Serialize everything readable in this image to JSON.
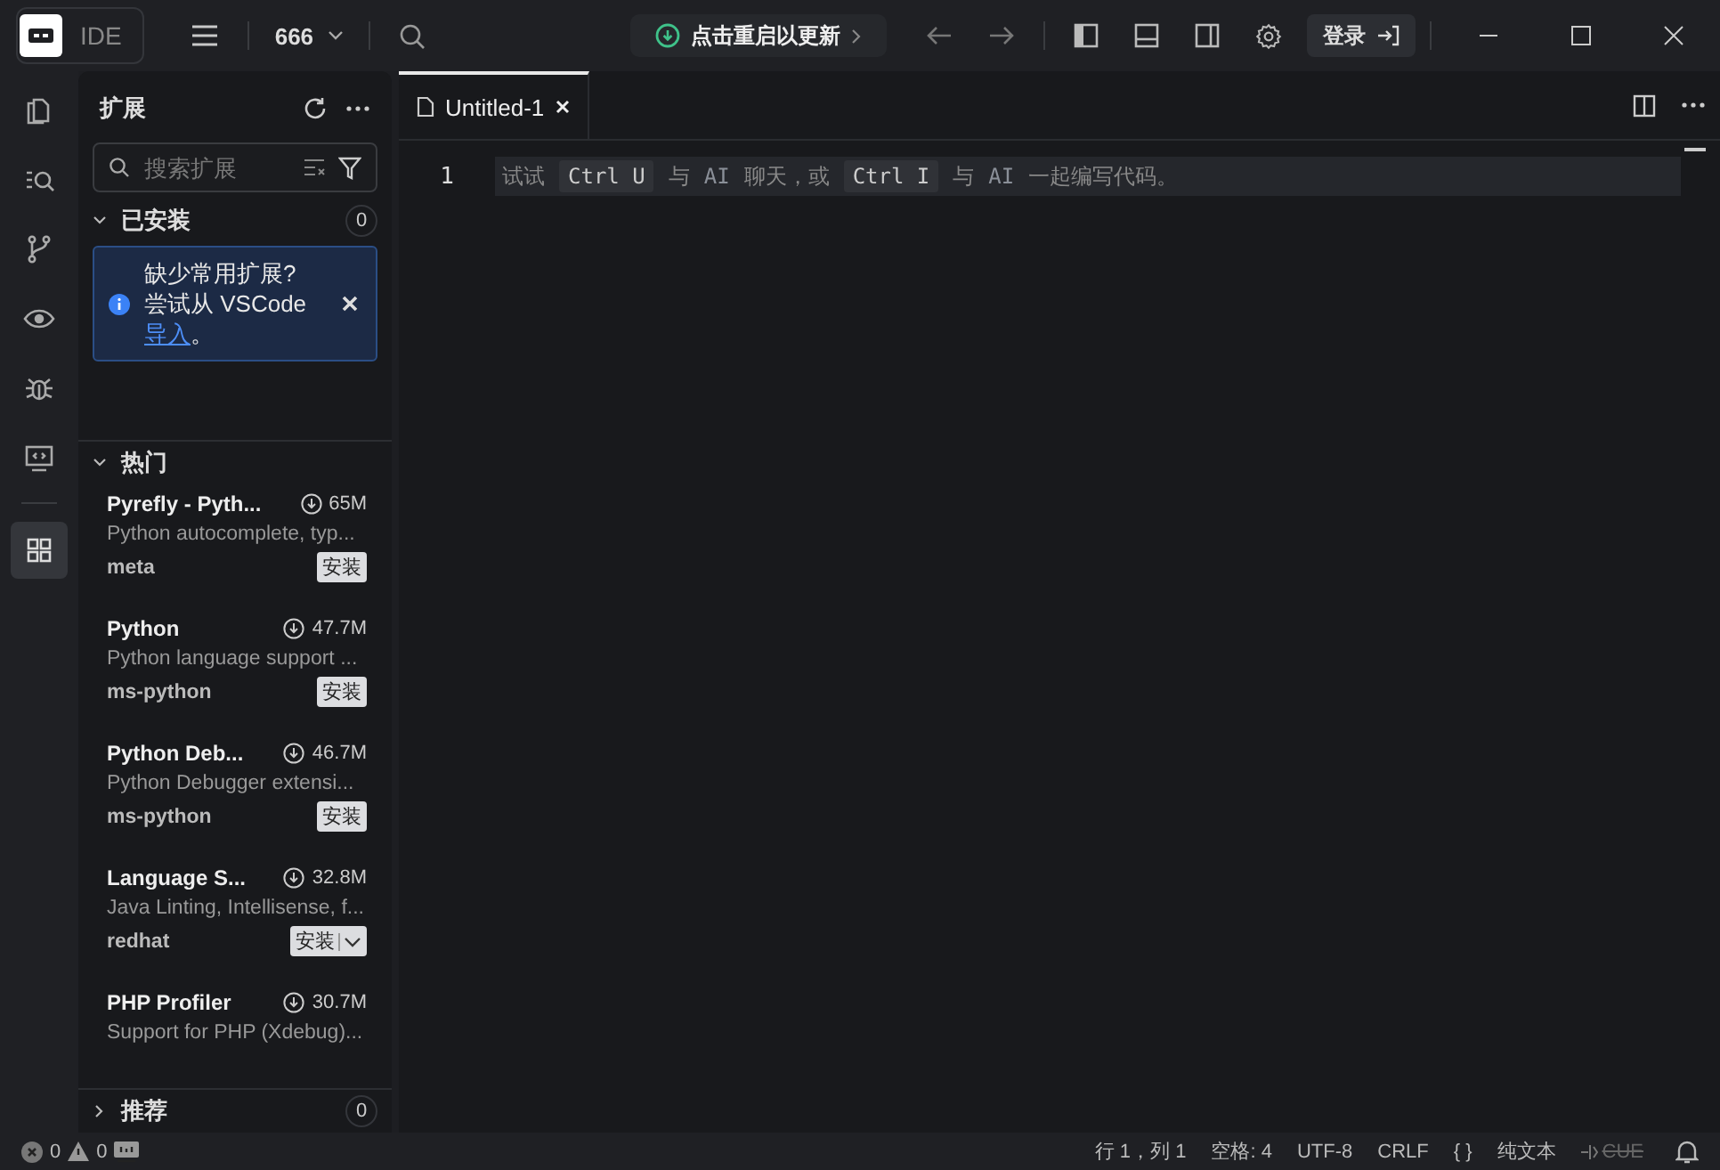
{
  "titlebar": {
    "app_label": "IDE",
    "project": "666",
    "update_button": "点击重启以更新",
    "login_button": "登录"
  },
  "activity_bar": [
    {
      "kind": "files",
      "selected": false
    },
    {
      "kind": "search",
      "selected": false
    },
    {
      "kind": "branch",
      "selected": false
    },
    {
      "kind": "eye",
      "selected": false
    },
    {
      "kind": "bug",
      "selected": false
    },
    {
      "kind": "monitor",
      "selected": false
    },
    {
      "kind": "extensions",
      "selected": true
    }
  ],
  "sidebar": {
    "title": "扩展",
    "search": {
      "placeholder": "搜索扩展"
    },
    "installed": {
      "title": "已安装",
      "count": "0",
      "expanded": true,
      "notice": {
        "line1": "缺少常用扩展?",
        "line2": "尝试从 VSCode",
        "link": "导入",
        "tail": "。"
      }
    },
    "popular": {
      "title": "热门",
      "expanded": true,
      "items": [
        {
          "name": "Pyrefly - Pyth...",
          "downloads": "65M",
          "description": "Python autocomplete, typ...",
          "publisher": "meta",
          "install": "安装",
          "kind": "plain"
        },
        {
          "name": "Python",
          "downloads": "47.7M",
          "description": "Python language support ...",
          "publisher": "ms-python",
          "install": "安装",
          "kind": "plain"
        },
        {
          "name": "Python Deb...",
          "downloads": "46.7M",
          "description": "Python Debugger extensi...",
          "publisher": "ms-python",
          "install": "安装",
          "kind": "plain"
        },
        {
          "name": "Language S...",
          "downloads": "32.8M",
          "description": "Java Linting, Intellisense, f...",
          "publisher": "redhat",
          "install": "安装",
          "kind": "split"
        },
        {
          "name": "PHP Profiler",
          "downloads": "30.7M",
          "description": "Support for PHP (Xdebug)...",
          "kind": "partial"
        }
      ]
    },
    "recommended": {
      "title": "推荐",
      "count": "0",
      "expanded": false
    }
  },
  "editor": {
    "tabs": [
      {
        "label": "Untitled-1",
        "selected": true
      }
    ],
    "line_number": "1",
    "hint": [
      {
        "kind": "text",
        "text": "试试"
      },
      {
        "kind": "key",
        "text": "Ctrl U"
      },
      {
        "kind": "text",
        "text": "与"
      },
      {
        "kind": "ai",
        "text": "AI"
      },
      {
        "kind": "text",
        "text": "聊天，或"
      },
      {
        "kind": "key",
        "text": "Ctrl I"
      },
      {
        "kind": "text",
        "text": "与"
      },
      {
        "kind": "ai",
        "text": "AI"
      },
      {
        "kind": "text",
        "text": "一起编写代码。"
      }
    ]
  },
  "status_bar": {
    "errors": "0",
    "warnings": "0",
    "items": [
      {
        "text": "行 1，列 1",
        "disabled": false
      },
      {
        "text": "空格: 4",
        "disabled": false
      },
      {
        "text": "UTF-8",
        "disabled": false
      },
      {
        "text": "CRLF",
        "disabled": false
      },
      {
        "text": "{ }",
        "disabled": false
      },
      {
        "text": "纯文本",
        "disabled": false
      },
      {
        "text": "CUE",
        "disabled": true
      }
    ]
  }
}
